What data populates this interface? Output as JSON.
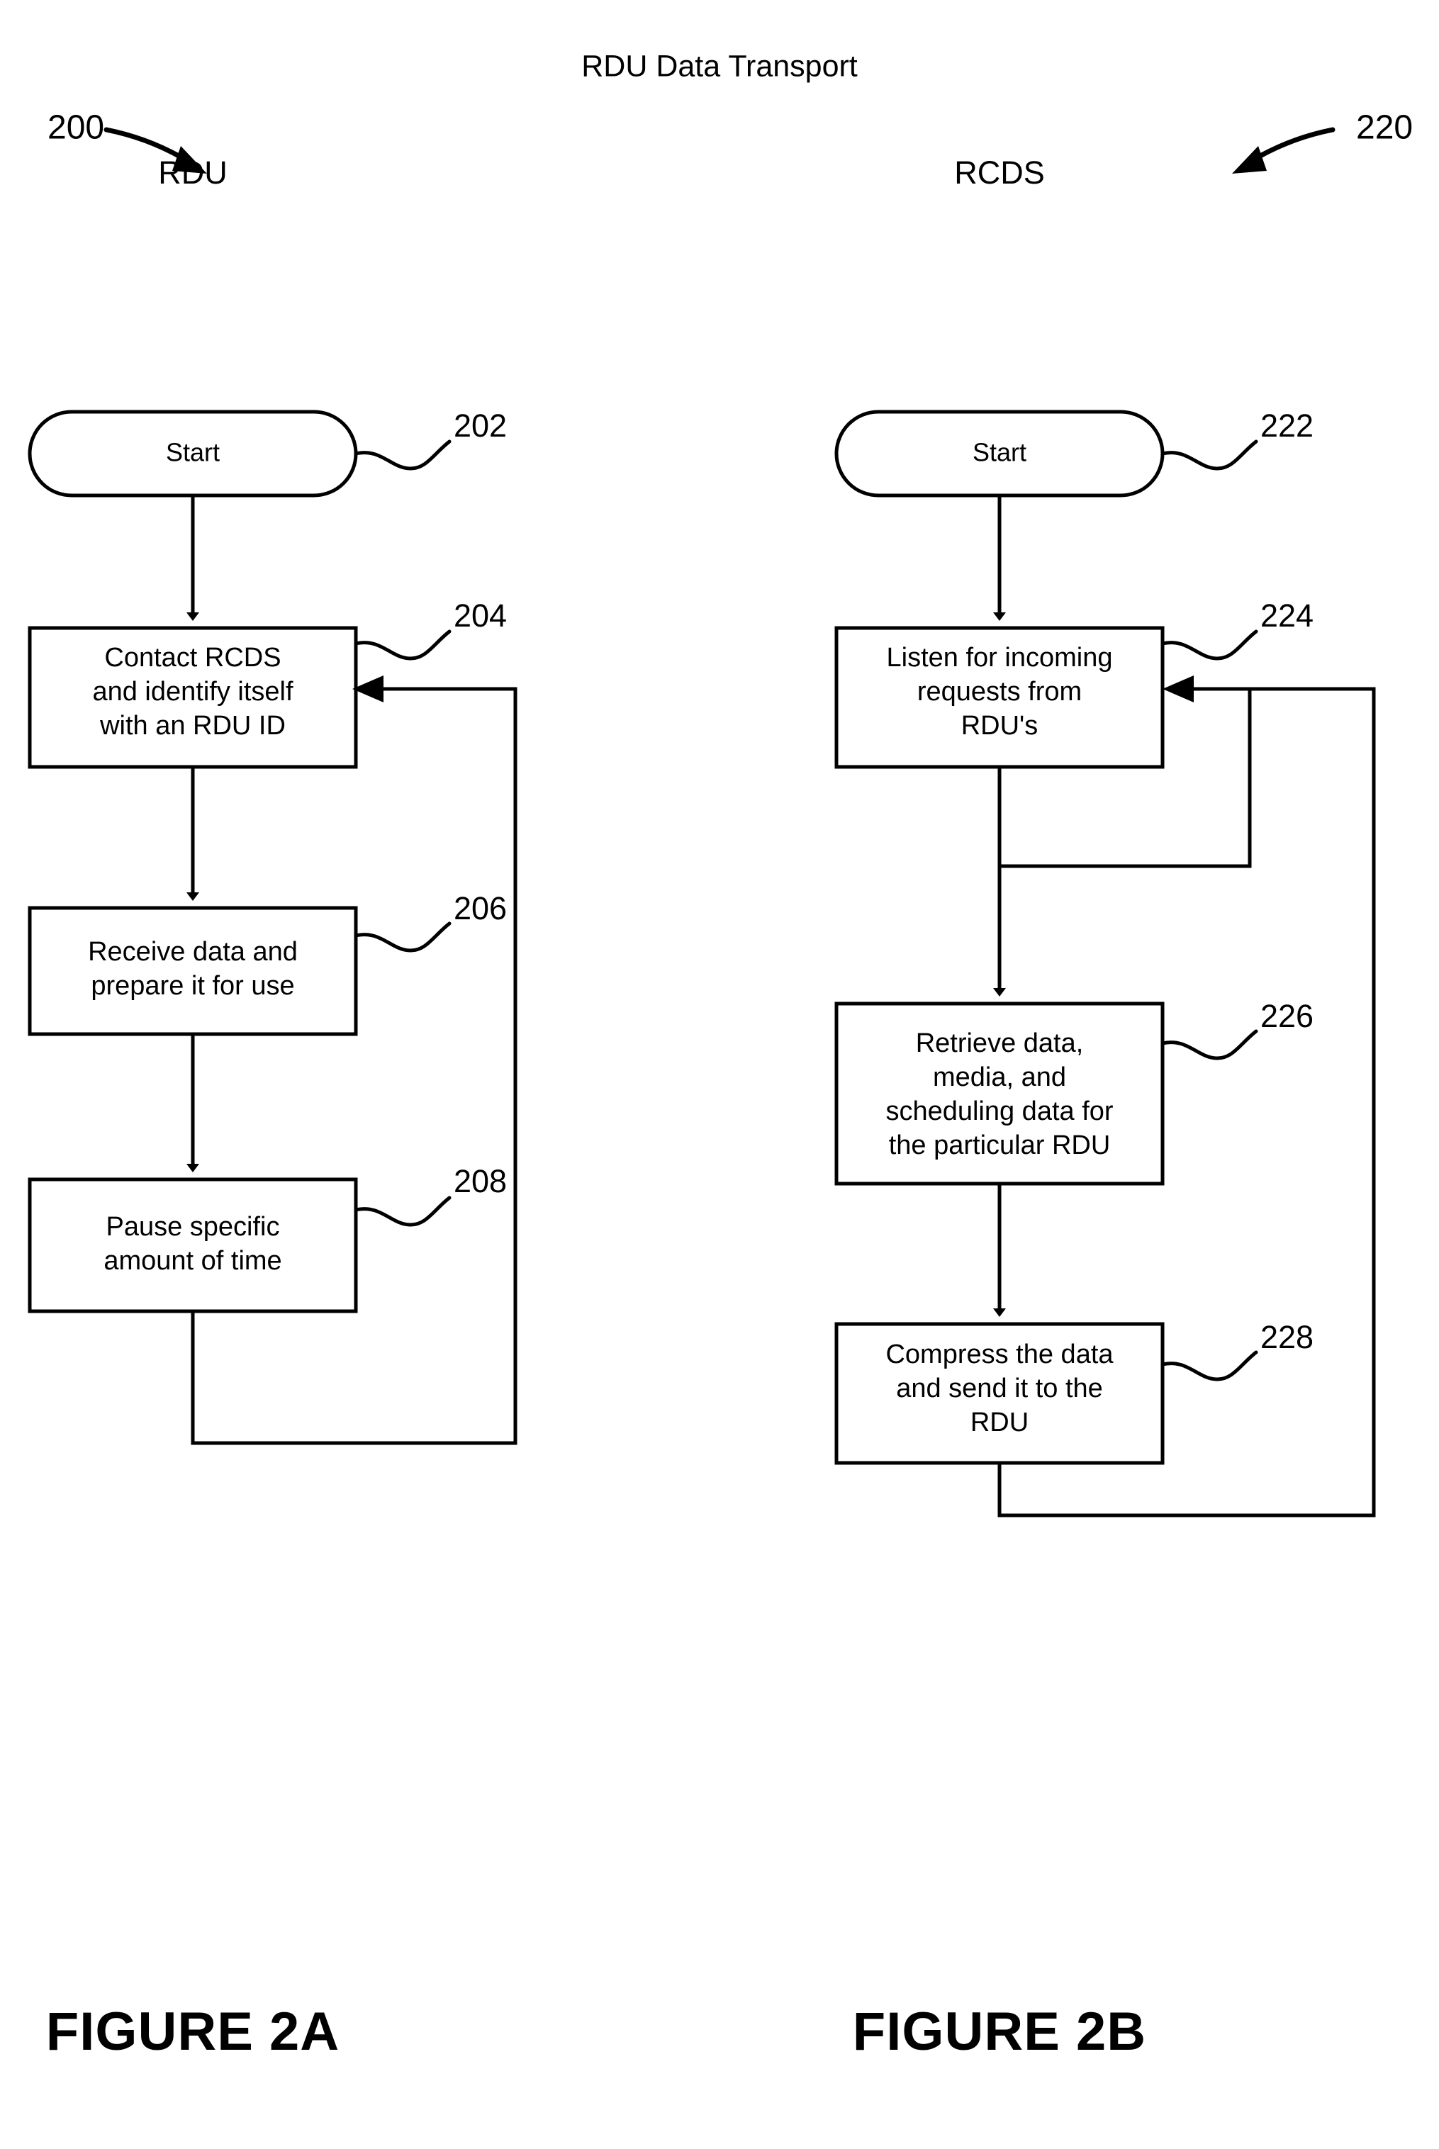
{
  "diagram": {
    "title": "RDU Data Transport"
  },
  "left_figure": {
    "caption": "FIGURE 2A",
    "ref_number": "200",
    "column_header": "RDU",
    "nodes": [
      {
        "id": "start",
        "label": "Start",
        "ref": "202",
        "shape": "stadium"
      },
      {
        "id": "step204",
        "label": "Contact RCDS\nand identify itself\nwith an RDU ID",
        "ref": "204",
        "shape": "rect",
        "lines": [
          "Contact RCDS",
          "and identify itself",
          "with an RDU ID"
        ]
      },
      {
        "id": "step206",
        "label": "Receive data and\nprepare it for use",
        "ref": "206",
        "shape": "rect",
        "lines": [
          "Receive data and",
          "prepare it for use"
        ]
      },
      {
        "id": "step208",
        "label": "Pause specific\namount of time",
        "ref": "208",
        "shape": "rect",
        "lines": [
          "Pause specific",
          "amount of time"
        ]
      }
    ],
    "loop_description": "Pause specific amount of time loops back to Contact RCDS and identify itself with an RDU ID"
  },
  "right_figure": {
    "caption": "FIGURE 2B",
    "ref_number": "220",
    "column_header": "RCDS",
    "nodes": [
      {
        "id": "start",
        "label": "Start",
        "ref": "222",
        "shape": "stadium"
      },
      {
        "id": "step224",
        "label": "Listen for incoming\nrequests from\nRDU's",
        "ref": "224",
        "shape": "rect",
        "lines": [
          "Listen for incoming",
          "requests from",
          "RDU's"
        ]
      },
      {
        "id": "step226",
        "label": "Retrieve data,\nmedia, and\nscheduling data for\nthe particular RDU",
        "ref": "226",
        "shape": "rect",
        "lines": [
          "Retrieve data,",
          "media, and",
          "scheduling data for",
          "the particular RDU"
        ]
      },
      {
        "id": "step228",
        "label": "Compress the data\nand send it to the\nRDU",
        "ref": "228",
        "shape": "rect",
        "lines": [
          "Compress the data",
          "and send it to the",
          "RDU"
        ]
      }
    ],
    "loop_description": "Inner loop from Listen step and outer loop from Compress step both return to Listen for incoming requests from RDU's"
  },
  "colors": {
    "ink": "#000000",
    "paper": "#ffffff"
  }
}
